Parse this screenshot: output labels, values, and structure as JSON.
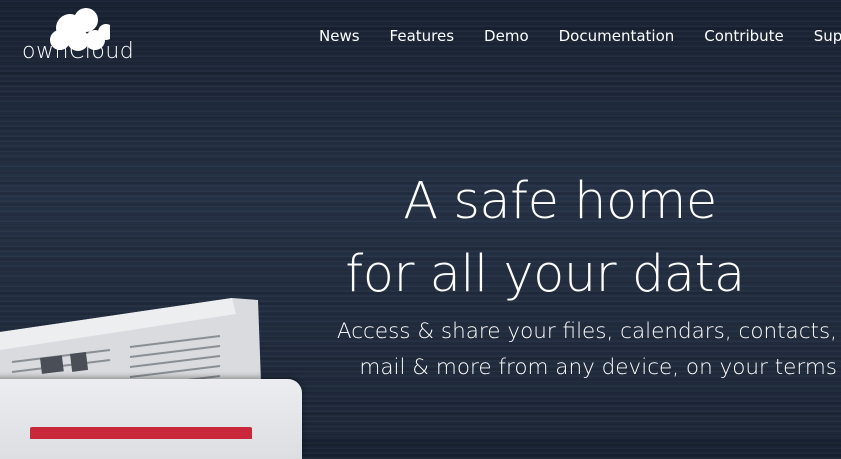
{
  "brand": {
    "logo_text": "ownCloud",
    "logo_icon": "cloud-icon"
  },
  "nav": {
    "items": [
      {
        "label": "News"
      },
      {
        "label": "Features"
      },
      {
        "label": "Demo"
      },
      {
        "label": "Documentation"
      },
      {
        "label": "Contribute"
      },
      {
        "label": "Supp"
      }
    ]
  },
  "hero": {
    "headline": [
      "A safe home",
      "for all your data"
    ],
    "subline": [
      "Access & share your files, calendars, contacts,",
      "mail & more from any device, on your terms"
    ]
  },
  "colors": {
    "background": "#1c2535",
    "text": "#ffffff",
    "accent_red": "#c8283a"
  }
}
